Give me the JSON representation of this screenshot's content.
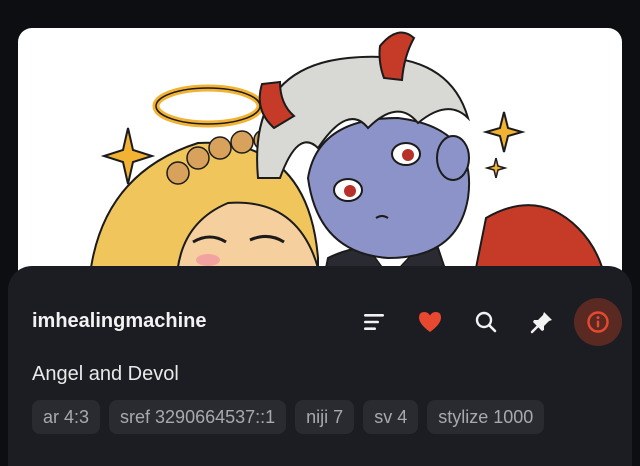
{
  "post": {
    "username": "imhealingmachine",
    "title": "Angel and Devol",
    "tags": [
      "ar 4:3",
      "sref 3290664537::1",
      "niji 7",
      "sv 4",
      "stylize 1000"
    ]
  },
  "toolbar": {
    "icons": [
      "menu-icon",
      "heart-icon",
      "search-icon",
      "pin-icon",
      "info-icon"
    ],
    "active": "info-icon"
  },
  "colors": {
    "accent": "#e8482f",
    "panel": "#1c1d22",
    "active_bg": "#5a2a22",
    "tag_bg": "#2a2b31"
  }
}
